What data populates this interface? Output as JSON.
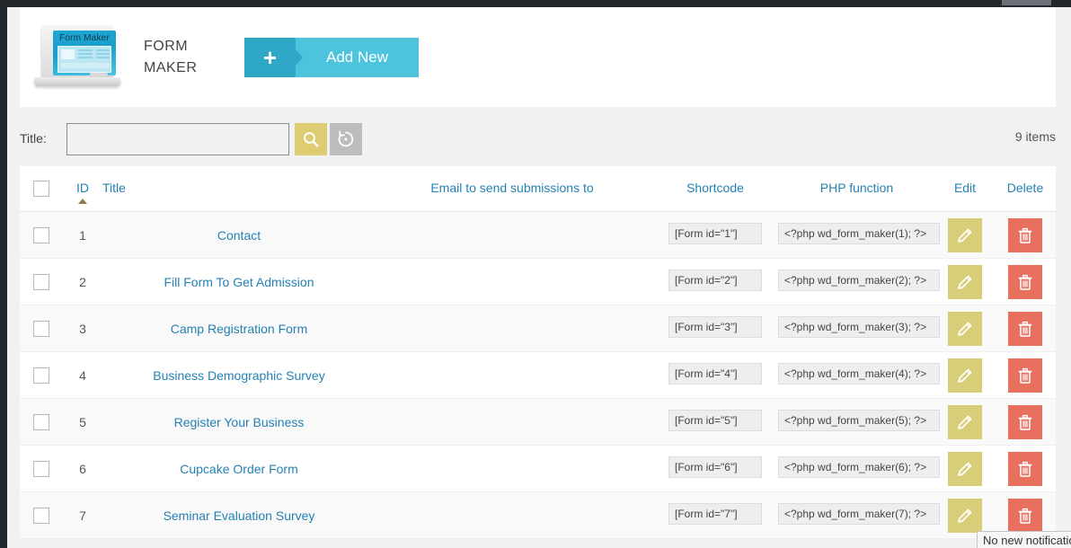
{
  "app": {
    "brand_name": "FORM MAKER",
    "brand_line1": "FORM",
    "brand_line2": "MAKER",
    "logo_caption": "Form Maker",
    "add_new_label": "Add New",
    "plus_glyph": "+"
  },
  "filter": {
    "title_label": "Title:",
    "title_value": "",
    "title_placeholder": "",
    "search_icon": "search-icon",
    "reset_icon": "reset-icon",
    "items_count": "9 items"
  },
  "table": {
    "columns": {
      "checkbox": "",
      "id": "ID",
      "title": "Title",
      "email": "Email to send submissions to",
      "shortcode": "Shortcode",
      "php": "PHP function",
      "edit": "Edit",
      "delete": "Delete"
    },
    "sort": {
      "column": "ID",
      "direction": "asc"
    },
    "rows": [
      {
        "id": "1",
        "title": "Contact",
        "email": "",
        "shortcode": "[Form id=\"1\"]",
        "php": "<?php wd_form_maker(1); ?>"
      },
      {
        "id": "2",
        "title": "Fill Form To Get Admission",
        "email": "",
        "shortcode": "[Form id=\"2\"]",
        "php": "<?php wd_form_maker(2); ?>"
      },
      {
        "id": "3",
        "title": "Camp Registration Form",
        "email": "",
        "shortcode": "[Form id=\"3\"]",
        "php": "<?php wd_form_maker(3); ?>"
      },
      {
        "id": "4",
        "title": "Business Demographic Survey",
        "email": "",
        "shortcode": "[Form id=\"4\"]",
        "php": "<?php wd_form_maker(4); ?>"
      },
      {
        "id": "5",
        "title": "Register Your Business",
        "email": "",
        "shortcode": "[Form id=\"5\"]",
        "php": "<?php wd_form_maker(5); ?>"
      },
      {
        "id": "6",
        "title": "Cupcake Order Form",
        "email": "",
        "shortcode": "[Form id=\"6\"]",
        "php": "<?php wd_form_maker(6); ?>"
      },
      {
        "id": "7",
        "title": "Seminar Evaluation Survey",
        "email": "",
        "shortcode": "[Form id=\"7\"]",
        "php": "<?php wd_form_maker(7); ?>"
      }
    ]
  },
  "notification": {
    "tooltip_text": "No new notifications"
  },
  "colors": {
    "accent_cyan": "#4ec3de",
    "accent_cyan_dark": "#2ea8c6",
    "search_gold": "#ddcc72",
    "edit_gold": "#d8cd79",
    "delete_red": "#e8705f",
    "link_blue": "#2481b3",
    "admin_dark": "#23282d"
  }
}
